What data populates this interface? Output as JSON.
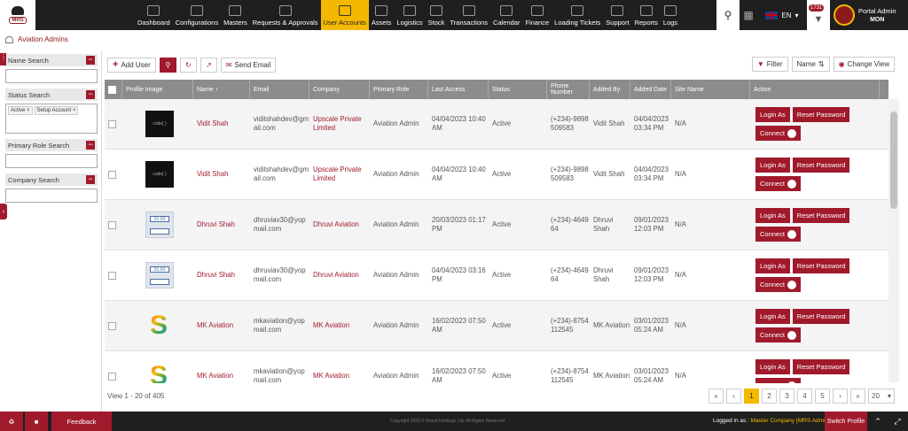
{
  "nav": [
    "Dashboard",
    "Configurations",
    "Masters",
    "Requests & Approvals",
    "User Accounts",
    "Assets",
    "Logistics",
    "Stock",
    "Transactions",
    "Calendar",
    "Finance",
    "Loading Tickets",
    "Support",
    "Reports",
    "Logs"
  ],
  "nav_active": "User Accounts",
  "logo_text": "MRS",
  "language": "EN",
  "notification_count": "1731",
  "user": {
    "name": "Portal Admin",
    "code": "MON"
  },
  "breadcrumb": "Aviation Admins",
  "sidebar": {
    "name_search": "Name Search",
    "status_search": "Status Search",
    "status_tags": [
      "Active ×",
      "Setup Account ×"
    ],
    "primary_role_search": "Primary Role Search",
    "company_search": "Company Search"
  },
  "toolbar": {
    "add_user": "Add User",
    "send_email": "Send Email",
    "filter": "Filter",
    "name_sort": "Name",
    "change_view": "Change View"
  },
  "columns": [
    "Profile Image",
    "Name ↑",
    "Email",
    "Company",
    "Primary Role",
    "Last Access",
    "Status",
    "Phone Number",
    "Added By",
    "Added Date",
    "Site Name",
    "Action"
  ],
  "rows": [
    {
      "img": "codelab",
      "name": "Vidit Shah",
      "email": "viditshahdev@gmail.com",
      "company": "Upscale Private Limited",
      "role": "Aviation Admin",
      "access": "04/04/2023 10:40 AM",
      "status": "Active",
      "phone": "(+234)-9898509583",
      "by": "Vidit Shah",
      "date": "04/04/2023 03:34 PM",
      "site": "N/A"
    },
    {
      "img": "codelab",
      "name": "Vidit Shah",
      "email": "viditshahdev@gmail.com",
      "company": "Upscale Private Limited",
      "role": "Aviation Admin",
      "access": "04/04/2023 10:40 AM",
      "status": "Active",
      "phone": "(+234)-9898509583",
      "by": "Vidit Shah",
      "date": "04/04/2023 03:34 PM",
      "site": "N/A"
    },
    {
      "img": "sign",
      "name": "Dhruvi Shah",
      "email": "dhruviav30@yopmail.com",
      "company": "Dhruvi Aviation",
      "role": "Aviation Admin",
      "access": "20/03/2023 01:17 PM",
      "status": "Active",
      "phone": "(+234)-464964",
      "by": "Dhruvi Shah",
      "date": "09/01/2023 12:03 PM",
      "site": "N/A"
    },
    {
      "img": "sign",
      "name": "Dhruvi Shah",
      "email": "dhruviav30@yopmail.com",
      "company": "Dhruvi Aviation",
      "role": "Aviation Admin",
      "access": "04/04/2023 03:16 PM",
      "status": "Active",
      "phone": "(+234)-464964",
      "by": "Dhruvi Shah",
      "date": "09/01/2023 12:03 PM",
      "site": "N/A"
    },
    {
      "img": "google",
      "name": "MK Aviation",
      "email": "mkaviation@yopmail.com",
      "company": "MK Aviation",
      "role": "Aviation Admin",
      "access": "16/02/2023 07:50 AM",
      "status": "Active",
      "phone": "(+234)-8754112545",
      "by": "MK Aviation",
      "date": "03/01/2023 05:24 AM",
      "site": "N/A"
    },
    {
      "img": "google",
      "name": "MK Aviation",
      "email": "mkaviation@yopmail.com",
      "company": "MK Aviation",
      "role": "Aviation Admin",
      "access": "16/02/2023 07:50 AM",
      "status": "Active",
      "phone": "(+234)-8754112545",
      "by": "MK Aviation",
      "date": "03/01/2023 05:24 AM",
      "site": "N/A"
    }
  ],
  "actions": {
    "login_as": "Login As",
    "reset_password": "Reset Password",
    "connect": "Connect"
  },
  "image_texts": {
    "codelab": "code{ }",
    "sign": "01.00",
    "google": "S"
  },
  "footer": {
    "view": "View 1 - 20 of 405",
    "pages": [
      "1",
      "2",
      "3",
      "4",
      "5"
    ],
    "current_page": "1",
    "page_size": "20",
    "first": "«",
    "prev": "‹",
    "next": "›",
    "last": "»"
  },
  "bottom": {
    "feedback": "Feedback",
    "copyright": "Copyright 2023 © Bonaf Holdings Ltd. All Rights Reserved",
    "logged_in_label": "Logged in as :",
    "logged_in_value": "Master Company [MRS Admin]",
    "switch_profile": "Switch Profile"
  },
  "colors": {
    "brand": "#a01a2c",
    "accent": "#f5b800",
    "dark": "#1f1f1f"
  }
}
